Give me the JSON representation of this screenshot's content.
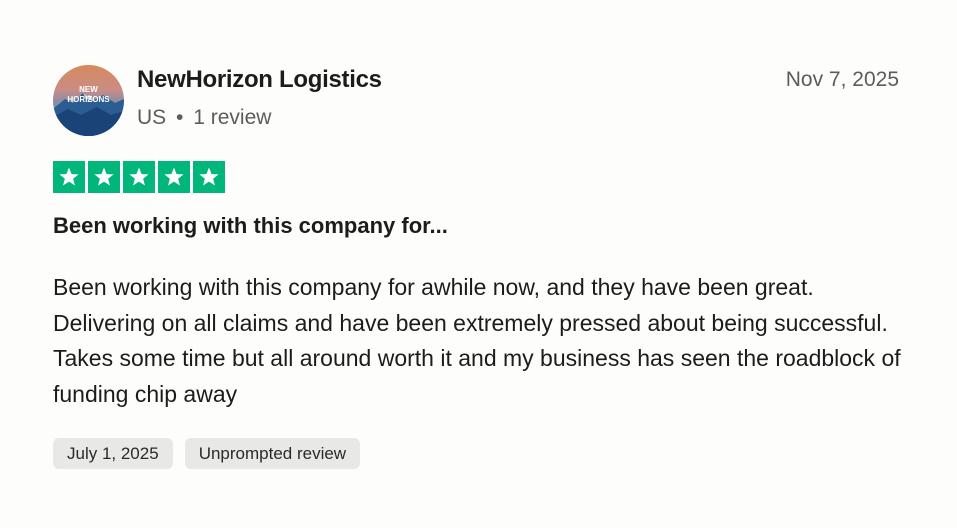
{
  "reviewer": {
    "name": "NewHorizon Logistics",
    "country": "US",
    "separator": "•",
    "review_count": "1 review",
    "avatar_text_line1": "NEW",
    "avatar_text_line2": "HORIZONS"
  },
  "review": {
    "date": "Nov 7, 2025",
    "rating": 5,
    "rating_max": 5,
    "star_color": "#00b67a",
    "title": "Been working with this company for...",
    "body": "Been working with this company for awhile now, and they have been great. Delivering on all claims and have been extremely pressed about being successful. Takes some time but all around worth it and my business has seen the roadblock of funding chip away"
  },
  "tags": [
    {
      "label": "July 1, 2025"
    },
    {
      "label": "Unprompted review"
    }
  ],
  "icons": {
    "star": "star-icon",
    "avatar": "logo-avatar"
  }
}
